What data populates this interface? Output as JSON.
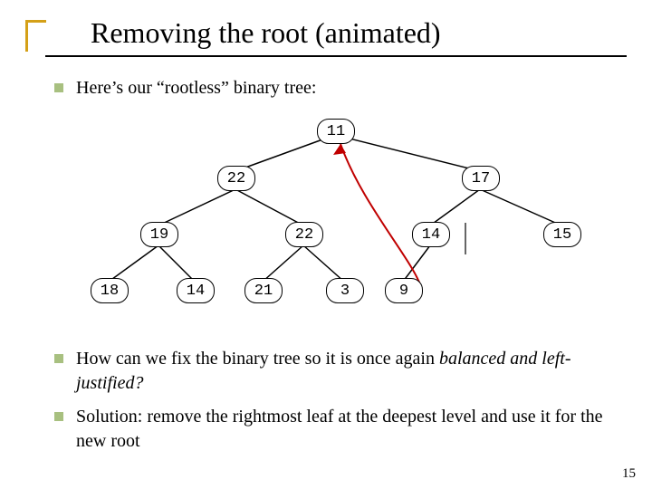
{
  "title": "Removing the root (animated)",
  "intro": "Here’s our “rootless” binary tree:",
  "tree": {
    "root": "11",
    "l2_left": "22",
    "l2_right": "17",
    "l3_a": "19",
    "l3_b": "22",
    "l3_c": "14",
    "l3_d": "15",
    "l4_a": "18",
    "l4_b": "14",
    "l4_c": "21",
    "l4_d": "3",
    "l4_e": "9"
  },
  "q_prefix": "How can we fix the binary tree so it is once again ",
  "q_em": "balanced and left-justified?",
  "sol": "Solution: remove the rightmost leaf at the deepest level and use it for the new root",
  "slide_number": "15"
}
